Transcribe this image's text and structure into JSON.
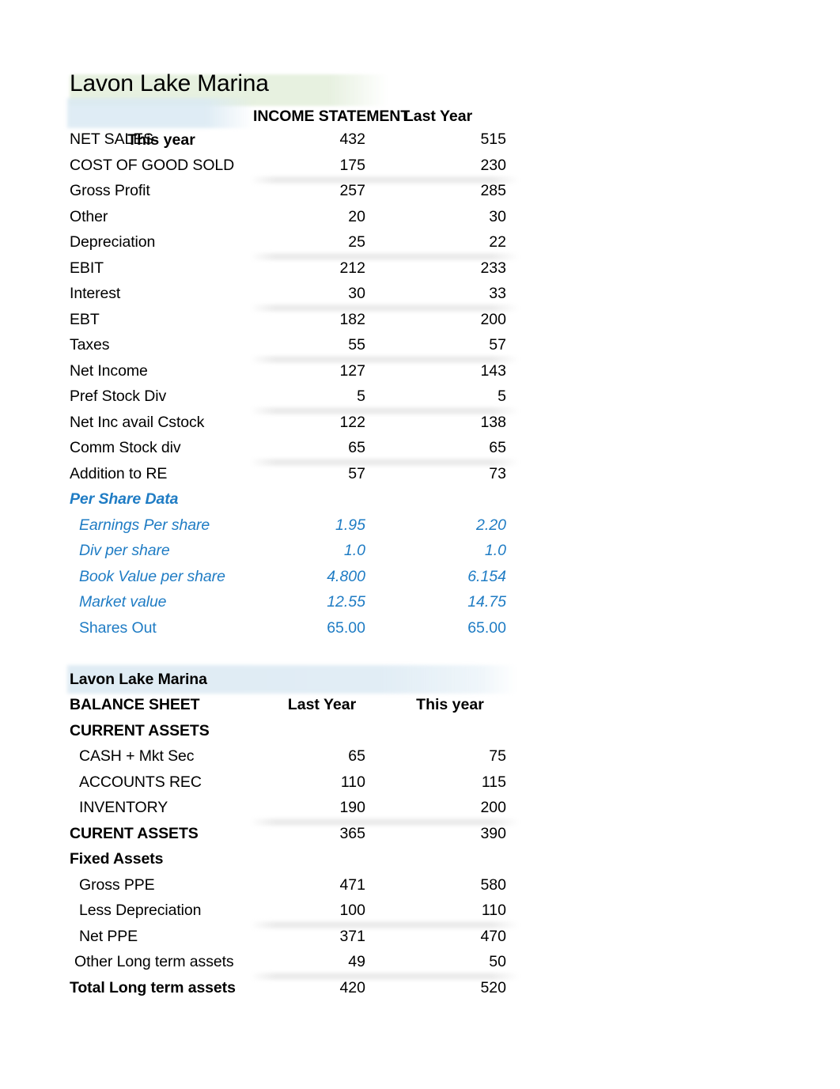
{
  "income_statement": {
    "company": "Lavon Lake Marina",
    "section_title": "INCOME STATEMENT",
    "col_last": "Last Year",
    "col_this": "This year",
    "rows": [
      {
        "label": "NET SALES",
        "last": "432",
        "this": "515"
      },
      {
        "label": "COST OF GOOD SOLD",
        "last": "175",
        "this": "230"
      },
      {
        "label": "Gross Profit",
        "last": "257",
        "this": "285"
      },
      {
        "label": "Other",
        "last": "20",
        "this": "30"
      },
      {
        "label": "Depreciation",
        "last": "25",
        "this": "22"
      },
      {
        "label": "EBIT",
        "last": "212",
        "this": "233"
      },
      {
        "label": "Interest",
        "last": "30",
        "this": "33"
      },
      {
        "label": "EBT",
        "last": "182",
        "this": "200"
      },
      {
        "label": "Taxes",
        "last": "55",
        "this": "57"
      },
      {
        "label": "Net Income",
        "last": "127",
        "this": "143"
      },
      {
        "label": "Pref Stock Div",
        "last": "5",
        "this": "5"
      },
      {
        "label": "Net Inc avail Cstock",
        "last": "122",
        "this": "138"
      },
      {
        "label": "Comm Stock div",
        "last": "65",
        "this": "65"
      },
      {
        "label": "Addition to RE",
        "last": "57",
        "this": "73"
      }
    ]
  },
  "per_share_data": {
    "heading": "Per Share Data",
    "rows": [
      {
        "label": "Earnings Per share",
        "last": "1.95",
        "this": "2.20"
      },
      {
        "label": "Div per share",
        "last": "1.0",
        "this": "1.0"
      },
      {
        "label": "Book Value per share",
        "last": "4.800",
        "this": "6.154"
      },
      {
        "label": "Market value",
        "last": "12.55",
        "this": "14.75"
      },
      {
        "label": "Shares Out",
        "last": "65.00",
        "this": "65.00"
      }
    ]
  },
  "balance_sheet": {
    "company": "Lavon Lake Marina",
    "section_title": "BALANCE SHEET",
    "col_last": "Last Year",
    "col_this": "This year",
    "current_assets_heading": "CURRENT ASSETS",
    "current_assets_rows": [
      {
        "label": "CASH + Mkt Sec",
        "last": "65",
        "this": "75"
      },
      {
        "label": "ACCOUNTS REC",
        "last": "110",
        "this": "115"
      },
      {
        "label": "INVENTORY",
        "last": "190",
        "this": "200"
      }
    ],
    "current_assets_total": {
      "label": "CURENT ASSETS",
      "last": "365",
      "this": "390"
    },
    "fixed_assets_heading": "Fixed Assets",
    "fixed_assets_rows": [
      {
        "label": "Gross PPE",
        "last": "471",
        "this": "580"
      },
      {
        "label": "Less Depreciation",
        "last": "100",
        "this": "110"
      },
      {
        "label": "Net PPE",
        "last": "371",
        "this": "470"
      }
    ],
    "other_long_term": {
      "label": "Other Long term assets",
      "last": "49",
      "this": "50"
    },
    "total_long_term": {
      "label": "Total Long term assets",
      "last": "420",
      "this": "520"
    }
  },
  "colors": {
    "blue_text": "#1f7cc4",
    "green_highlight": "#e6f0df",
    "blue_highlight": "#dce9f3",
    "divider": "#ececec"
  }
}
